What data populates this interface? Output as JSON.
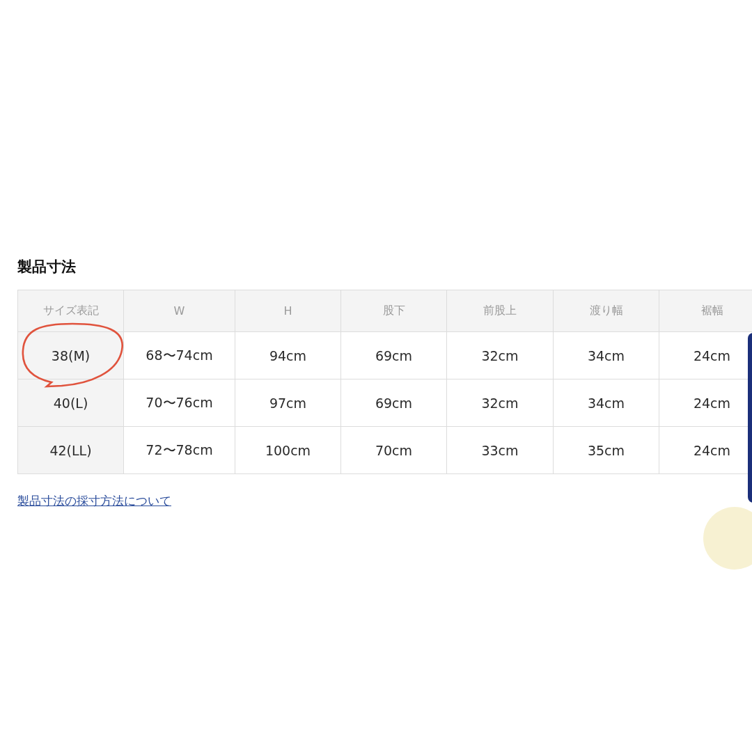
{
  "section_title": "製品寸法",
  "table": {
    "columns": [
      "サイズ表記",
      "W",
      "H",
      "股下",
      "前股上",
      "渡り幅",
      "裾幅"
    ],
    "rows": [
      {
        "cells": [
          "38(M)",
          "68〜74cm",
          "94cm",
          "69cm",
          "32cm",
          "34cm",
          "24cm"
        ],
        "circled": true
      },
      {
        "cells": [
          "40(L)",
          "70〜76cm",
          "97cm",
          "69cm",
          "32cm",
          "34cm",
          "24cm"
        ],
        "circled": false
      },
      {
        "cells": [
          "42(LL)",
          "72〜78cm",
          "100cm",
          "70cm",
          "33cm",
          "35cm",
          "24cm"
        ],
        "circled": false
      }
    ]
  },
  "link": "製品寸法の採寸方法について"
}
